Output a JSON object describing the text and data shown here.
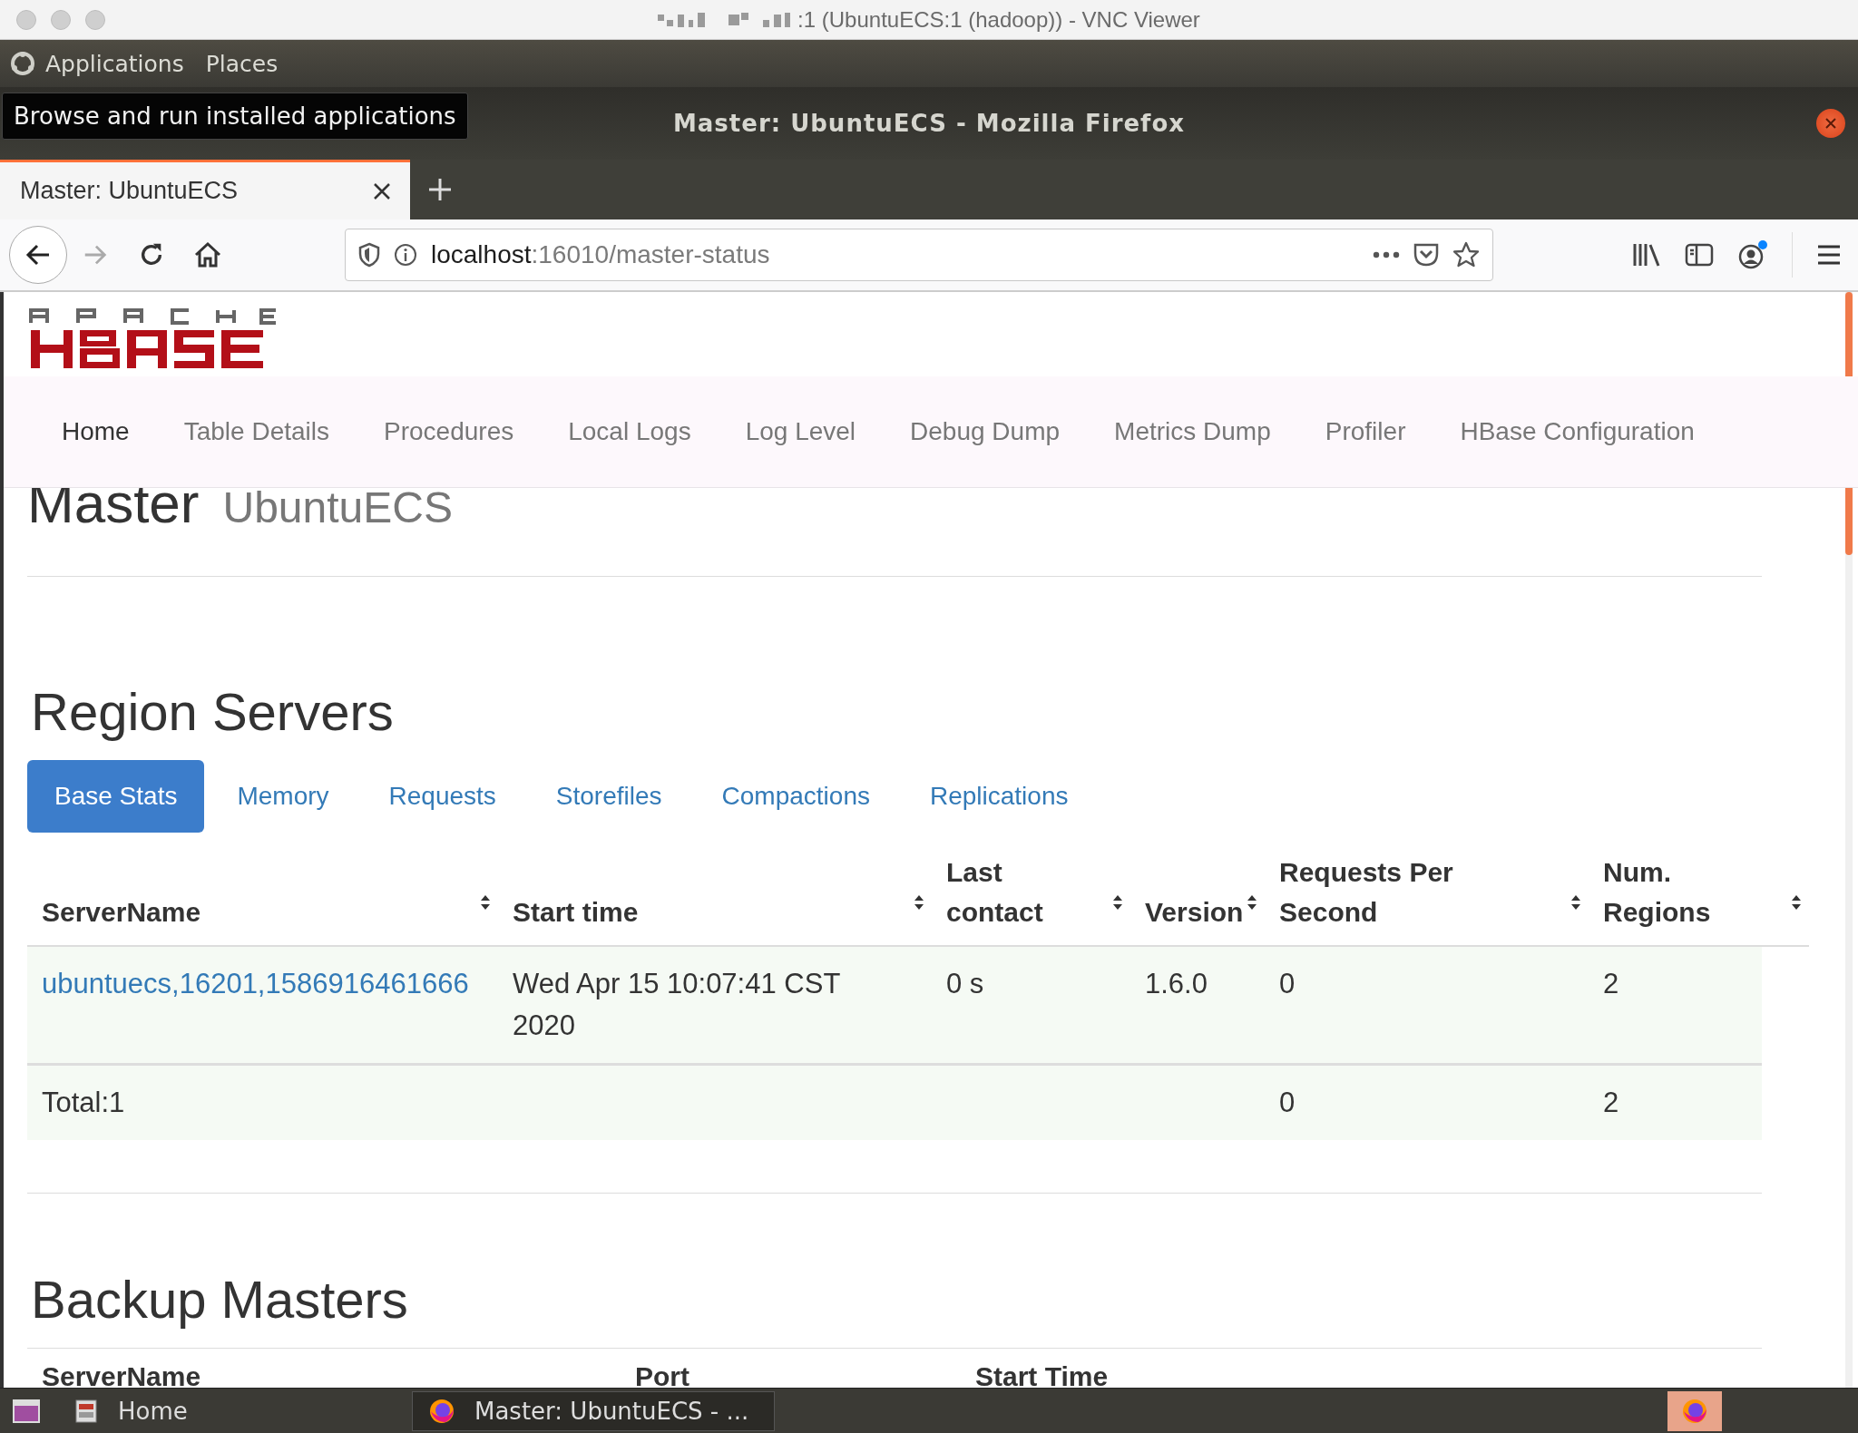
{
  "vnc_window": {
    "title": ":1 (UbuntuECS:1 (hadoop)) - VNC Viewer"
  },
  "top_panel": {
    "menus": [
      "Applications",
      "Places"
    ],
    "tooltip": "Browse and run installed applications"
  },
  "firefox_window": {
    "title": "Master: UbuntuECS - Mozilla Firefox"
  },
  "tabs": [
    {
      "label": "Master: UbuntuECS",
      "selected": true
    }
  ],
  "address_bar": {
    "host": "localhost",
    "path": ":16010/master-status"
  },
  "page": {
    "nav": [
      {
        "label": "Home",
        "selected": true
      },
      {
        "label": "Table Details",
        "selected": false
      },
      {
        "label": "Procedures",
        "selected": false
      },
      {
        "label": "Local Logs",
        "selected": false
      },
      {
        "label": "Log Level",
        "selected": false
      },
      {
        "label": "Debug Dump",
        "selected": false
      },
      {
        "label": "Metrics Dump",
        "selected": false
      },
      {
        "label": "Profiler",
        "selected": false
      },
      {
        "label": "HBase Configuration",
        "selected": false
      }
    ],
    "heading": {
      "title": "Master",
      "subtitle": "UbuntuECS"
    },
    "region_servers": {
      "title": "Region Servers",
      "tabs": [
        {
          "label": "Base Stats",
          "selected": true
        },
        {
          "label": "Memory",
          "selected": false
        },
        {
          "label": "Requests",
          "selected": false
        },
        {
          "label": "Storefiles",
          "selected": false
        },
        {
          "label": "Compactions",
          "selected": false
        },
        {
          "label": "Replications",
          "selected": false
        }
      ],
      "columns": [
        "ServerName",
        "Start time",
        "Last contact",
        "Version",
        "Requests Per Second",
        "Num. Regions"
      ],
      "rows": [
        [
          "ubuntuecs,16201,1586916461666",
          "Wed Apr 15 10:07:41 CST 2020",
          "0 s",
          "1.6.0",
          "0",
          "2"
        ]
      ],
      "total": {
        "label": "Total:1",
        "requests": "0",
        "regions": "2"
      }
    },
    "backup_masters": {
      "title": "Backup Masters",
      "columns": [
        "ServerName",
        "Port",
        "Start Time"
      ]
    }
  },
  "taskbar": {
    "items": [
      {
        "label": "Home",
        "selected": false
      },
      {
        "label": "Master: UbuntuECS - ...",
        "selected": true
      }
    ]
  }
}
